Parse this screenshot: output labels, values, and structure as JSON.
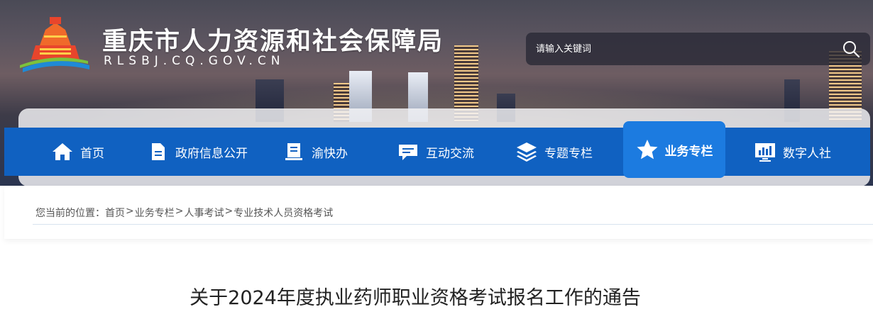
{
  "header": {
    "title": "重庆市人力资源和社会保障局",
    "domain": "RLSBJ.CQ.GOV.CN",
    "logo_icon": "cq-hrss-emblem-icon"
  },
  "search": {
    "placeholder": "请输入关键词",
    "value": "",
    "icon": "search-icon"
  },
  "nav": {
    "items": [
      {
        "label": "首页",
        "icon": "home-icon"
      },
      {
        "label": "政府信息公开",
        "icon": "document-icon"
      },
      {
        "label": "渝快办",
        "icon": "book-icon"
      },
      {
        "label": "互动交流",
        "icon": "chat-icon"
      },
      {
        "label": "专题专栏",
        "icon": "layers-icon"
      },
      {
        "label": "业务专栏",
        "icon": "star-icon",
        "active": true
      },
      {
        "label": "数字人社",
        "icon": "monitor-chart-icon"
      }
    ],
    "bar_color": "#1061c1",
    "active_color": "#1c7be0"
  },
  "breadcrumb": {
    "prefix": "您当前的位置：",
    "separator": ">",
    "items": [
      "首页",
      "业务专栏",
      "人事考试",
      "专业技术人员资格考试"
    ]
  },
  "article": {
    "title": "关于2024年度执业药师职业资格考试报名工作的通告"
  }
}
